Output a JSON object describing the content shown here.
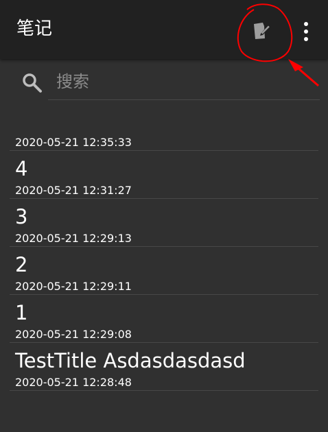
{
  "appbar": {
    "title": "笔记",
    "new_note_icon": "compose-icon",
    "overflow_icon": "more-vert-icon",
    "background": "#212121"
  },
  "search": {
    "placeholder": "搜索",
    "value": "",
    "icon": "search-icon"
  },
  "notes": [
    {
      "title": "",
      "date": "2020-05-21 12:35:33"
    },
    {
      "title": "4",
      "date": "2020-05-21 12:31:27"
    },
    {
      "title": "3",
      "date": "2020-05-21 12:29:13"
    },
    {
      "title": "2",
      "date": "2020-05-21 12:29:11"
    },
    {
      "title": "1",
      "date": "2020-05-21 12:29:08"
    },
    {
      "title": "TestTitle Asdasdasdasd",
      "date": "2020-05-21 12:28:48"
    }
  ],
  "annotation": {
    "color": "#ff0000"
  }
}
